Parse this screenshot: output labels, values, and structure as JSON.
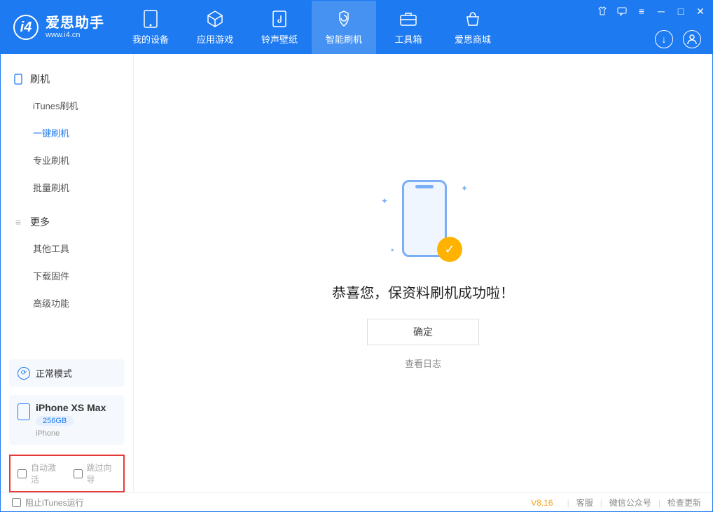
{
  "app": {
    "title": "爱思助手",
    "subtitle": "www.i4.cn"
  },
  "nav": {
    "tabs": [
      {
        "label": "我的设备",
        "icon": "device-icon"
      },
      {
        "label": "应用游戏",
        "icon": "cube-icon"
      },
      {
        "label": "铃声壁纸",
        "icon": "music-icon"
      },
      {
        "label": "智能刷机",
        "icon": "flash-icon"
      },
      {
        "label": "工具箱",
        "icon": "toolbox-icon"
      },
      {
        "label": "爱思商城",
        "icon": "shop-icon"
      }
    ],
    "active_index": 3
  },
  "header_icons": {
    "download": "↓",
    "user": "👤"
  },
  "sidebar": {
    "section1": {
      "title": "刷机"
    },
    "items1": [
      {
        "label": "iTunes刷机"
      },
      {
        "label": "一键刷机",
        "active": true
      },
      {
        "label": "专业刷机"
      },
      {
        "label": "批量刷机"
      }
    ],
    "section2": {
      "title": "更多"
    },
    "items2": [
      {
        "label": "其他工具"
      },
      {
        "label": "下载固件"
      },
      {
        "label": "高级功能"
      }
    ]
  },
  "device": {
    "mode": "正常模式",
    "model": "iPhone XS Max",
    "storage": "256GB",
    "type": "iPhone"
  },
  "checkboxes": {
    "auto_activate": "自动激活",
    "skip_guide": "跳过向导"
  },
  "main": {
    "success_title": "恭喜您，保资料刷机成功啦！",
    "ok_button": "确定",
    "log_link": "查看日志"
  },
  "footer": {
    "block_itunes": "阻止iTunes运行",
    "version": "V8.16",
    "links": {
      "support": "客服",
      "wechat": "微信公众号",
      "update": "检查更新"
    }
  }
}
